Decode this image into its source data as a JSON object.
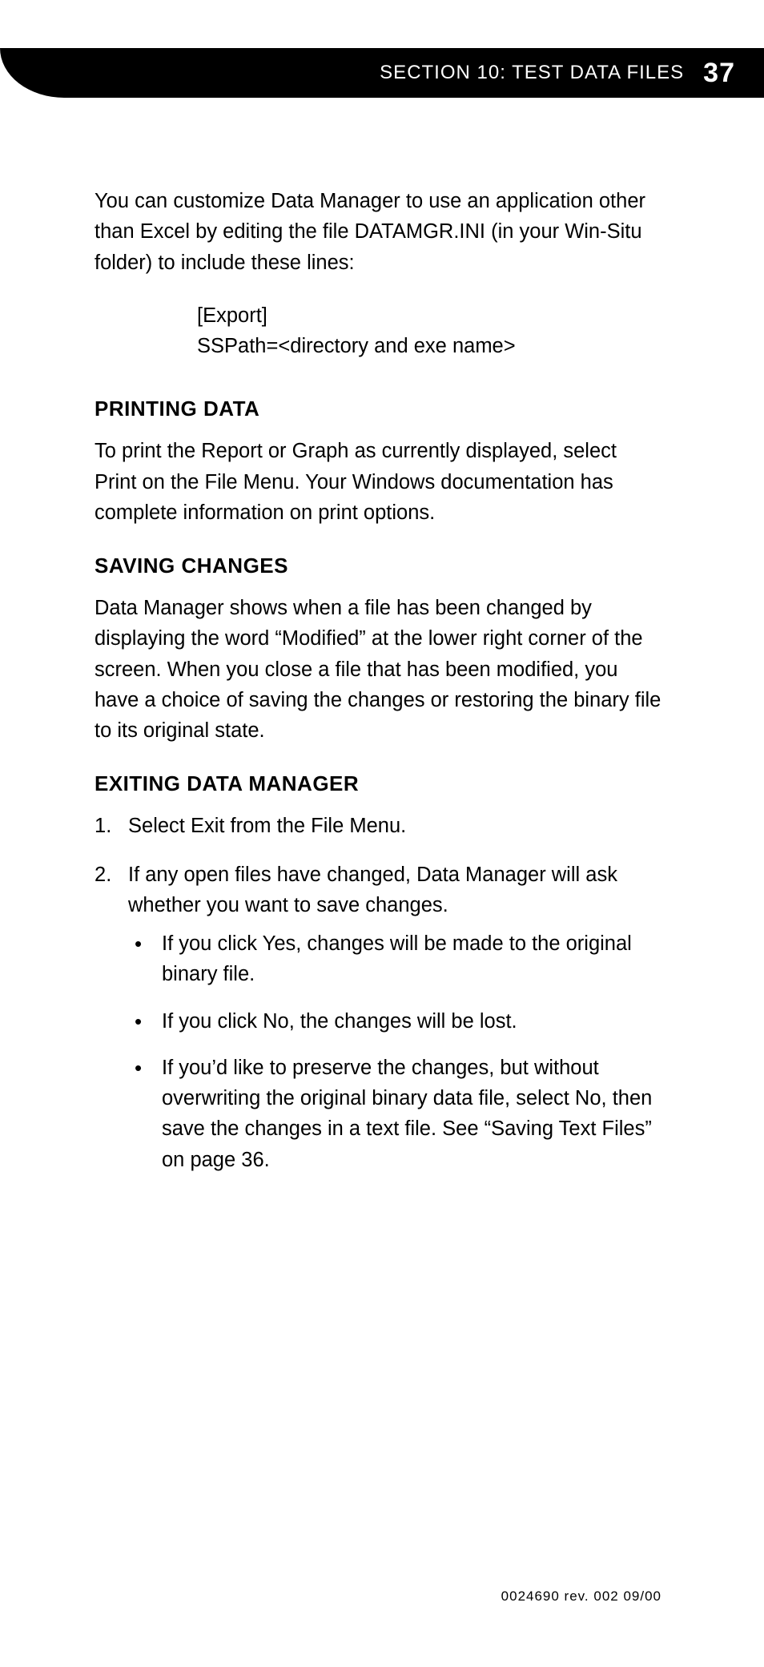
{
  "header": {
    "section_label": "SECTION 10: TEST DATA FILES",
    "page_number": "37"
  },
  "body": {
    "intro_para": "You can customize Data Manager to use an application other than Excel by editing the file DATAMGR.INI (in your Win-Situ folder) to include these lines:",
    "code_lines": {
      "l1": "[Export]",
      "l2": "SSPath=<directory and exe name>"
    },
    "printing": {
      "heading": "PRINTING DATA",
      "para": "To print the Report or Graph as currently displayed, select Print on the File Menu. Your Windows documentation has complete information on print options."
    },
    "saving": {
      "heading": "SAVING CHANGES",
      "para": "Data Manager shows when a file has been changed by displaying the word “Modified” at the lower right corner of the screen. When you close a file that has been modified, you have a choice of saving the changes or restoring the binary file to its original state."
    },
    "exiting": {
      "heading": "EXITING DATA MANAGER",
      "steps": {
        "s1": "Select Exit from the File Menu.",
        "s2": "If any open files have changed, Data Manager will ask whether you want to save changes."
      },
      "bullets": {
        "b1": "If you click Yes, changes will be made to the original binary file.",
        "b2": "If you click No, the changes will be lost.",
        "b3": "If you’d like to preserve the changes, but without overwriting the original binary data file, select No, then save the changes in a text file. See “Saving Text Files” on page 36."
      }
    }
  },
  "footer": {
    "text": "0024690  rev.  002   09/00"
  }
}
